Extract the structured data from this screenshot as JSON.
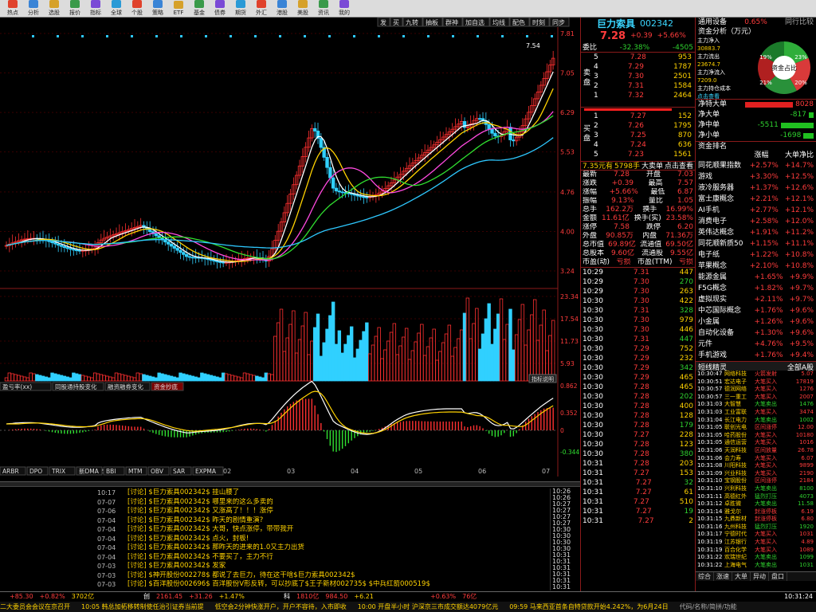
{
  "toolbar": {
    "items": [
      "热点",
      "分析",
      "选股",
      "报价",
      "指标",
      "全球",
      "个股",
      "策略",
      "ETF",
      "基金",
      "债券",
      "期货",
      "外汇",
      "港股",
      "美股",
      "资讯",
      "我的"
    ]
  },
  "chart": {
    "tabs": [
      "发",
      "买",
      "九转",
      "抽板",
      "群神",
      "加自选",
      "均线",
      "配色",
      "时刻",
      "同步"
    ],
    "price_axis": [
      "7.81",
      "7.05",
      "6.29",
      "5.53",
      "4.76",
      "4.00",
      "3.24"
    ],
    "price_high_label": "7.54",
    "volume_axis": [
      "23.34",
      "17.54",
      "11.73",
      "5.93"
    ],
    "indicator_tabs": [
      "盈亏率(xx)",
      "同股通持股变化",
      "融资融券变化",
      "资金抄底"
    ],
    "indicator_axis": [
      "0.862",
      "0.352",
      "0",
      "-0.344"
    ],
    "indicator_button": "指标说明",
    "date_axis": [
      "11",
      "12",
      "01",
      "02",
      "03",
      "04",
      "05",
      "06",
      "07"
    ],
    "bottom_tabs": [
      "ARBR",
      "DPO",
      "TRIX",
      "新DMA",
      "BBI",
      "MTM",
      "OBV",
      "SAR",
      "EXPMA"
    ]
  },
  "quote": {
    "name": "巨力索具",
    "code": "002342",
    "price": "7.28",
    "change": "+0.39",
    "change_pct": "+5.66%",
    "weibi_label": "委比",
    "weibi": "-32.38%",
    "weicha": "-4505",
    "sell_label": "卖盘",
    "buy_label": "买盘",
    "sell": [
      {
        "price": "7.32",
        "vol": "2464"
      },
      {
        "price": "7.31",
        "vol": "1584"
      },
      {
        "price": "7.30",
        "vol": "2501"
      },
      {
        "price": "7.29",
        "vol": "1787"
      },
      {
        "price": "7.28",
        "vol": "953"
      }
    ],
    "buy": [
      {
        "price": "7.27",
        "vol": "152"
      },
      {
        "price": "7.26",
        "vol": "1795"
      },
      {
        "price": "7.25",
        "vol": "870"
      },
      {
        "price": "7.24",
        "vol": "636"
      },
      {
        "price": "7.23",
        "vol": "1561"
      }
    ],
    "bigorder": {
      "a": "7.35元有",
      "b": "5798手",
      "c": "大卖单",
      "d": "点击查看"
    },
    "stats": [
      {
        "k": "最新",
        "v": "7.28",
        "k2": "开盘",
        "v2": "7.03"
      },
      {
        "k": "涨跌",
        "v": "+0.39",
        "k2": "最高",
        "v2": "7.57"
      },
      {
        "k": "涨幅",
        "v": "+5.66%",
        "k2": "最低",
        "v2": "6.87"
      },
      {
        "k": "振幅",
        "v": "9.13%",
        "k2": "量比",
        "v2": "1.05"
      },
      {
        "k": "总手",
        "v": "162.2万",
        "k2": "换手",
        "v2": "16.99%"
      },
      {
        "k": "金额",
        "v": "11.61亿",
        "k2": "换手(实)",
        "v2": "23.58%"
      },
      {
        "k": "涨停",
        "v": "7.58",
        "k2": "跌停",
        "v2": "6.20"
      },
      {
        "k": "外盘",
        "v": "90.85万",
        "k2": "内盘",
        "v2": "71.36万"
      },
      {
        "k": "总市值",
        "v": "69.89亿",
        "k2": "流通值",
        "v2": "69.50亿"
      },
      {
        "k": "总股本",
        "v": "9.60亿",
        "k2": "流通股",
        "v2": "9.55亿"
      },
      {
        "k": "市盈(动)",
        "v": "亏损",
        "k2": "市盈(TTM)",
        "v2": "亏损"
      }
    ],
    "ticks": [
      {
        "t": "10:29",
        "p": "7.31",
        "v": "447"
      },
      {
        "t": "10:29",
        "p": "7.30",
        "v": "270"
      },
      {
        "t": "10:29",
        "p": "7.30",
        "v": "263"
      },
      {
        "t": "10:30",
        "p": "7.30",
        "v": "422"
      },
      {
        "t": "10:30",
        "p": "7.31",
        "v": "328"
      },
      {
        "t": "10:30",
        "p": "7.30",
        "v": "979"
      },
      {
        "t": "10:30",
        "p": "7.30",
        "v": "446"
      },
      {
        "t": "10:30",
        "p": "7.31",
        "v": "447"
      },
      {
        "t": "10:30",
        "p": "7.29",
        "v": "752"
      },
      {
        "t": "10:30",
        "p": "7.29",
        "v": "232"
      },
      {
        "t": "10:30",
        "p": "7.29",
        "v": "342"
      },
      {
        "t": "10:30",
        "p": "7.29",
        "v": "465"
      },
      {
        "t": "10:30",
        "p": "7.28",
        "v": "465"
      },
      {
        "t": "10:30",
        "p": "7.28",
        "v": "202"
      },
      {
        "t": "10:30",
        "p": "7.28",
        "v": "400"
      },
      {
        "t": "10:30",
        "p": "7.28",
        "v": "128"
      },
      {
        "t": "10:30",
        "p": "7.28",
        "v": "179"
      },
      {
        "t": "10:30",
        "p": "7.27",
        "v": "228"
      },
      {
        "t": "10:30",
        "p": "7.28",
        "v": "123"
      },
      {
        "t": "10:30",
        "p": "7.28",
        "v": "380"
      },
      {
        "t": "10:31",
        "p": "7.28",
        "v": "203"
      },
      {
        "t": "10:31",
        "p": "7.27",
        "v": "153"
      },
      {
        "t": "10:31",
        "p": "7.27",
        "v": "32"
      },
      {
        "t": "10:31",
        "p": "7.27",
        "v": "61"
      },
      {
        "t": "10:31",
        "p": "7.27",
        "v": "510"
      },
      {
        "t": "10:31",
        "p": "7.27",
        "v": "19"
      },
      {
        "t": "10:31",
        "p": "7.27",
        "v": "2"
      }
    ]
  },
  "flow": {
    "header_l": "通用设备",
    "header_r": "0.65%",
    "subtitle": "资金分析（万元）",
    "labels": [
      "主力净入",
      "主力流出",
      "主力净流入",
      "主力持仓成本",
      "点击查看"
    ],
    "vals": [
      "30883.7",
      "23674.7",
      "7209.0"
    ],
    "pie_center": "资金占比",
    "pie_pcts": [
      "19%",
      "23%",
      "21%",
      "20%"
    ],
    "rows": [
      {
        "k": "净特大单",
        "v": "8028"
      },
      {
        "k": "净大单",
        "v": "-817"
      },
      {
        "k": "净中单",
        "v": "-5511"
      },
      {
        "k": "净小单",
        "v": "-1698"
      }
    ]
  },
  "sectors": {
    "title": "资金排名",
    "cols": [
      "涨幅",
      "大单净比"
    ],
    "rows": [
      {
        "n": "同花顺果指数",
        "a": "+2.57%",
        "b": "+14.7%"
      },
      {
        "n": "游戏",
        "a": "+3.30%",
        "b": "+12.5%"
      },
      {
        "n": "液冷服务器",
        "a": "+1.37%",
        "b": "+12.6%"
      },
      {
        "n": "富士康概念",
        "a": "+2.21%",
        "b": "+12.1%"
      },
      {
        "n": "AI手机",
        "a": "+2.77%",
        "b": "+12.1%"
      },
      {
        "n": "消费电子",
        "a": "+2.58%",
        "b": "+12.0%"
      },
      {
        "n": "英伟达概念",
        "a": "+1.91%",
        "b": "+11.2%"
      },
      {
        "n": "同花顺新质50",
        "a": "+1.15%",
        "b": "+11.1%"
      },
      {
        "n": "电子纸",
        "a": "+1.22%",
        "b": "+10.8%"
      },
      {
        "n": "苹果概念",
        "a": "+2.10%",
        "b": "+10.8%"
      },
      {
        "n": "能源金属",
        "a": "+1.65%",
        "b": "+9.9%"
      },
      {
        "n": "F5G概念",
        "a": "+1.82%",
        "b": "+9.7%"
      },
      {
        "n": "虚拟现实",
        "a": "+2.11%",
        "b": "+9.7%"
      },
      {
        "n": "中芯国际概念",
        "a": "+1.76%",
        "b": "+9.6%"
      },
      {
        "n": "小金属",
        "a": "+1.26%",
        "b": "+9.6%"
      },
      {
        "n": "自动化设备",
        "a": "+1.30%",
        "b": "+9.6%"
      },
      {
        "n": "元件",
        "a": "+4.76%",
        "b": "+9.5%"
      },
      {
        "n": "手机游戏",
        "a": "+1.76%",
        "b": "+9.4%"
      }
    ]
  },
  "radar": {
    "title": "短线精灵",
    "filter": "全部A股",
    "rows": [
      {
        "t": "10:30:47",
        "n": "网络科技",
        "e": "火箭发射",
        "v": "5.07"
      },
      {
        "t": "10:30:51",
        "n": "宏达电子",
        "e": "大笔买入",
        "v": "17819"
      },
      {
        "t": "10:30:57",
        "n": "德润网络",
        "e": "大笔买入",
        "v": "1276"
      },
      {
        "t": "10:30:57",
        "n": "三一重工",
        "e": "大笔买入",
        "v": "2007"
      },
      {
        "t": "10:31:03",
        "n": "大智慧",
        "e": "大笔卖出",
        "v": "1476"
      },
      {
        "t": "10:31:03",
        "n": "工业富联",
        "e": "大笔买入",
        "v": "3474"
      },
      {
        "t": "10:31:04",
        "n": "长江电力",
        "e": "大笔卖出",
        "v": "1002"
      },
      {
        "t": "10:31:05",
        "n": "联创光电",
        "e": "区间涨停",
        "v": "12.00"
      },
      {
        "t": "10:31:05",
        "n": "哈药股份",
        "e": "大笔买入",
        "v": "10180"
      },
      {
        "t": "10:31:05",
        "n": "通信运营",
        "e": "大笔买入",
        "v": "1016"
      },
      {
        "t": "10:31:06",
        "n": "天润科技",
        "e": "区间放量",
        "v": "26.78"
      },
      {
        "t": "10:31:06",
        "n": "会力寿",
        "e": "大笔买入",
        "v": "6.07"
      },
      {
        "t": "10:31:08",
        "n": "川阳科技",
        "e": "大笔买入",
        "v": "9899"
      },
      {
        "t": "10:31:09",
        "n": "兴业科技",
        "e": "大笔买入",
        "v": "2190"
      },
      {
        "t": "10:31:10",
        "n": "宝钢股份",
        "e": "区间涨停",
        "v": "2184"
      },
      {
        "t": "10:31:10",
        "n": "兴利科技",
        "e": "大笔卖出",
        "v": "8100"
      },
      {
        "t": "10:31:11",
        "n": "高德红外",
        "e": "猛烈打压",
        "v": "4073"
      },
      {
        "t": "10:31:12",
        "n": "卓胜微",
        "e": "大笔卖出",
        "v": "11.58"
      },
      {
        "t": "10:31:14",
        "n": "雅戈尔",
        "e": "封涨停板",
        "v": "6.19"
      },
      {
        "t": "10:31:15",
        "n": "九鼎新材",
        "e": "封涨停板",
        "v": "6.80"
      },
      {
        "t": "10:31:16",
        "n": "九州科技",
        "e": "猛烈打压",
        "v": "1920"
      },
      {
        "t": "10:31:17",
        "n": "宁德时代",
        "e": "大笔买入",
        "v": "1031"
      },
      {
        "t": "10:31:19",
        "n": "江苏银行",
        "e": "大笔买入",
        "v": "4.89"
      },
      {
        "t": "10:31:19",
        "n": "百合化学",
        "e": "大笔买入",
        "v": "1089"
      },
      {
        "t": "10:31:22",
        "n": "欢瑞世纪",
        "e": "大笔卖出",
        "v": "1099"
      },
      {
        "t": "10:31:22",
        "n": "上海电气",
        "e": "大笔卖出",
        "v": "1031"
      }
    ],
    "tabs": [
      "综合",
      "涨速",
      "大单",
      "异动",
      "盘口"
    ],
    "search": "代码/名称/简拼/功能"
  },
  "news": {
    "dates": [
      "10:17",
      "07-07",
      "07-06",
      "07-04",
      "07-04",
      "07-04",
      "07-04",
      "07-04",
      "07-03",
      "07-03",
      "07-03",
      "07-03",
      "07-03"
    ],
    "lines": [
      "[讨论] $巨力索具002342$ 挂山腰了",
      "[讨论] $巨力索具002342$ 哪里来的这么多卖的",
      "[讨论] $巨力索具002342$ 又涨高了！！！涨停",
      "[讨论] $巨力索具002342$ 昨天的剧情重演?",
      "[讨论] $巨力索具002342$ 大哥，快点涨停，带带我开",
      "[讨论] $巨力索具002342$ 点火，封板!",
      "[讨论] $巨力索具002342$ 那昨天的进来的1.0又主力出货",
      "[讨论] $巨力索具002342$ 不要买了，主力不行",
      "[讨论] $巨力索具002342$ 发家",
      "[讨论] $神开股份002278$ 都说了去巨力，待在这干啥$巨力索具002342$",
      "[讨论] $百洋股份002696$ 百洋股份V形反转，可以抄底了$王子新材002735$ $中兵红箭000519$"
    ],
    "right_times": [
      "10:26",
      "10:26",
      "10:27",
      "10:27",
      "10:27",
      "10:27",
      "10:30",
      "10:30",
      "10:30",
      "10:30",
      "10:31",
      "10:31",
      "10:31",
      "10:31",
      "10:31",
      "10:31"
    ]
  },
  "status": {
    "items": [
      "二大委员会会议在京召开",
      "10:05 韩总加拓移转制使任治引证券当前提",
      "低空会2分钟快涨开户，开户不容待，入市即收",
      "10:00 开盘半小时 沪深京三市成交额达4079亿元",
      "09:59 马来西亚首条自特贷款开始4.242%，为6月24日",
      "代码/名称/简拼/功能"
    ],
    "indices": [
      {
        "name": "",
        "val": "+85.30",
        "pct": "+0.82%",
        "amt": "3702亿"
      },
      {
        "name": "创",
        "val": "2161.45",
        "pct": "+31.26",
        "amt": "+1.47%"
      },
      {
        "name": "科",
        "val": "1810亿",
        "pct": "984.50",
        "amt": "+6.21"
      },
      {
        "name": "",
        "val": "+0.63%",
        "pct": "76亿",
        "amt": ""
      }
    ],
    "clock": "10:31:24"
  }
}
